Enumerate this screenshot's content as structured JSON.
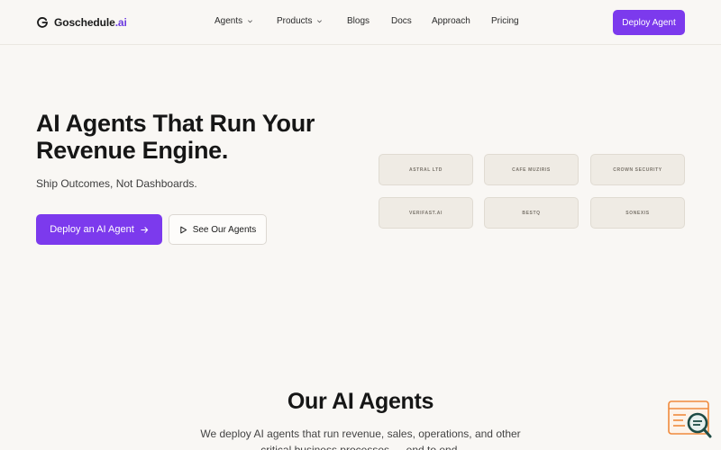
{
  "nav": {
    "brand_main": "Goschedule",
    "brand_accent": ".ai",
    "links": [
      {
        "label": "Agents",
        "dropdown": true
      },
      {
        "label": "Products",
        "dropdown": true
      },
      {
        "label": "Blogs",
        "dropdown": false
      },
      {
        "label": "Docs",
        "dropdown": false
      },
      {
        "label": "Approach",
        "dropdown": false
      },
      {
        "label": "Pricing",
        "dropdown": false
      }
    ],
    "cta_label": "Deploy Agent"
  },
  "hero": {
    "title_line1": "AI Agents That Run Your",
    "title_line2": "Revenue Engine.",
    "subtitle": "Ship Outcomes, Not Dashboards.",
    "primary_cta": "Deploy an AI Agent",
    "secondary_cta": "See Our Agents"
  },
  "clients": [
    "ASTRAL LTD",
    "CAFE MUZIRIS",
    "CROWN SECURITY",
    "VERIFAST.AI",
    "BESTQ",
    "SONEXIS"
  ],
  "agents_section": {
    "title": "Our AI Agents",
    "description": "We deploy AI agents that run revenue, sales, operations, and other critical business processes — end to end."
  },
  "colors": {
    "accent": "#7c3aed",
    "background": "#f9f7f4",
    "widget": "#f08a3c"
  }
}
